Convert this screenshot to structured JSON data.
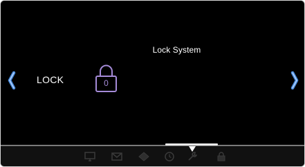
{
  "screen": {
    "title": "Lock System",
    "lock_label": "LOCK",
    "lock_value": "0"
  },
  "navigation": {
    "prev_icon": "chevron-left-icon",
    "next_icon": "chevron-right-icon"
  },
  "dock": {
    "icons": [
      "monitor-icon",
      "mail-icon",
      "diamond-icon",
      "clock-icon",
      "tool-icon",
      "lock-icon"
    ],
    "active": "tool-icon"
  },
  "colors": {
    "background": "#000000",
    "text": "#ffffff",
    "accent_blue": "#3f7fd4",
    "lock_purple": "#a58bd8",
    "dock_icon": "#3a3a3a"
  }
}
